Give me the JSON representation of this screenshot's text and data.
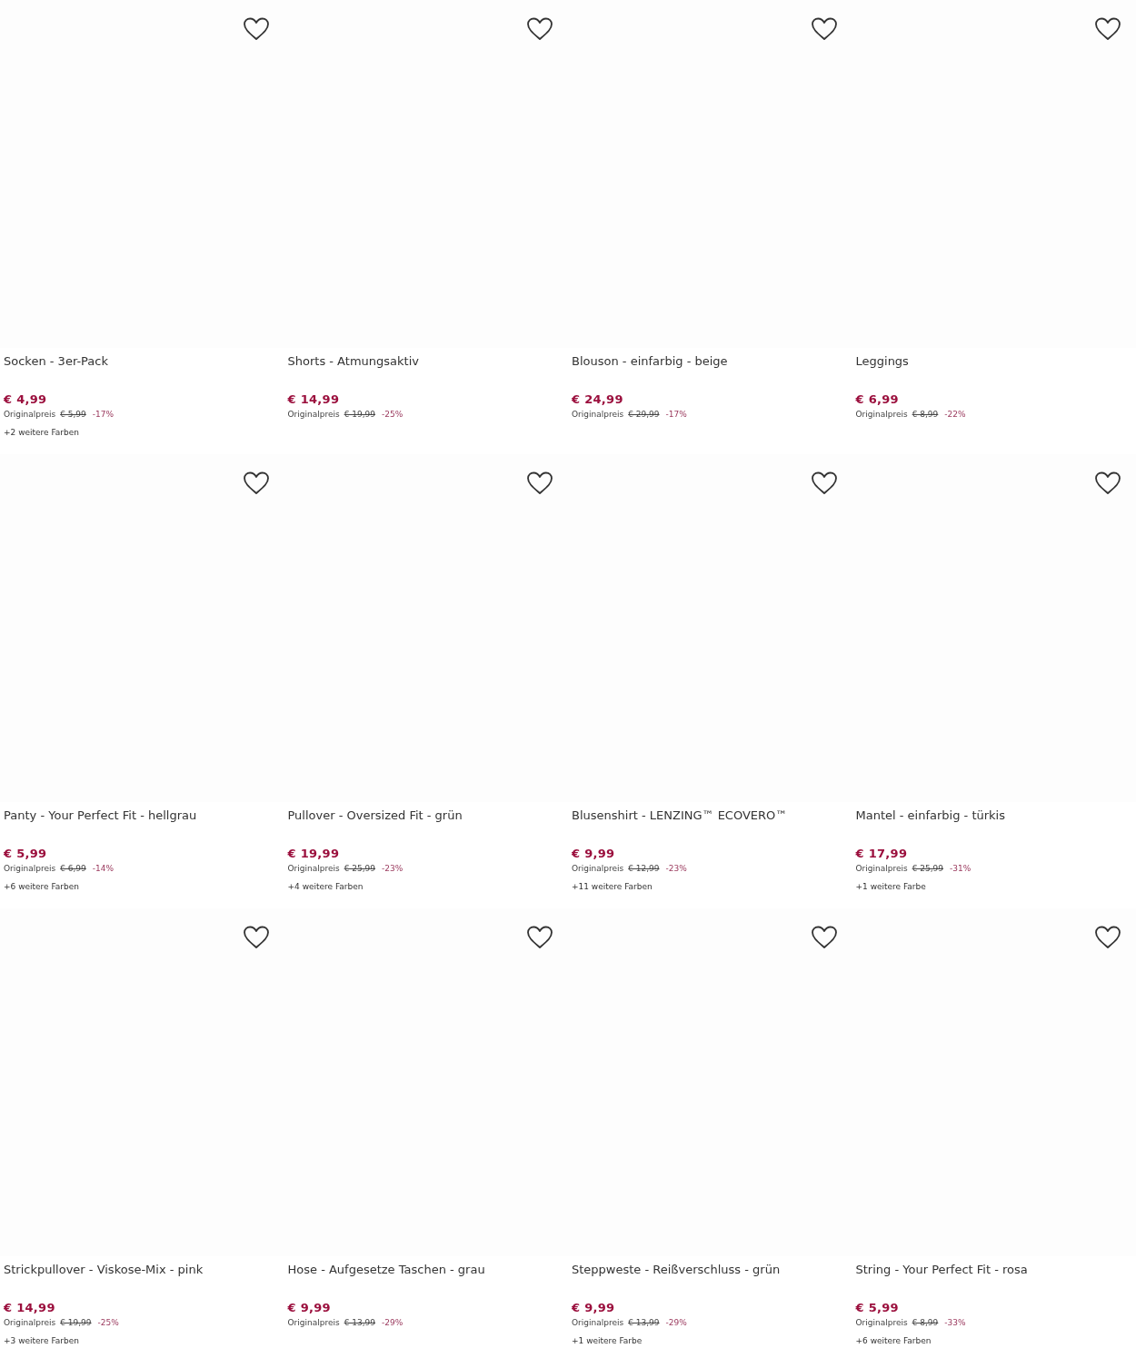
{
  "products": [
    {
      "name": "Socken - 3er-Pack",
      "price": "€ 4,99",
      "original_label": "Originalpreis",
      "original_price": "€ 5,99",
      "discount": "-17%",
      "colors": "+2 weitere Farben"
    },
    {
      "name": "Shorts - Atmungsaktiv",
      "price": "€ 14,99",
      "original_label": "Originalpreis",
      "original_price": "€ 19,99",
      "discount": "-25%"
    },
    {
      "name": "Blouson - einfarbig - beige",
      "price": "€ 24,99",
      "original_label": "Originalpreis",
      "original_price": "€ 29,99",
      "discount": "-17%"
    },
    {
      "name": "Leggings",
      "price": "€ 6,99",
      "original_label": "Originalpreis",
      "original_price": "€ 8,99",
      "discount": "-22%"
    },
    {
      "name": "Panty - Your Perfect Fit - hellgrau",
      "price": "€ 5,99",
      "original_label": "Originalpreis",
      "original_price": "€ 6,99",
      "discount": "-14%",
      "colors": "+6 weitere Farben"
    },
    {
      "name": "Pullover - Oversized Fit - grün",
      "price": "€ 19,99",
      "original_label": "Originalpreis",
      "original_price": "€ 25,99",
      "discount": "-23%",
      "colors": "+4 weitere Farben"
    },
    {
      "name": "Blusenshirt - LENZING™ ECOVERO™",
      "price": "€ 9,99",
      "original_label": "Originalpreis",
      "original_price": "€ 12,99",
      "discount": "-23%",
      "colors": "+11 weitere Farben"
    },
    {
      "name": "Mantel - einfarbig - türkis",
      "price": "€ 17,99",
      "original_label": "Originalpreis",
      "original_price": "€ 25,99",
      "discount": "-31%",
      "colors": "+1 weitere Farbe"
    },
    {
      "name": "Strickpullover - Viskose-Mix - pink",
      "price": "€ 14,99",
      "original_label": "Originalpreis",
      "original_price": "€ 19,99",
      "discount": "-25%",
      "colors": "+3 weitere Farben"
    },
    {
      "name": "Hose - Aufgesetze Taschen - grau",
      "price": "€ 9,99",
      "original_label": "Originalpreis",
      "original_price": "€ 13,99",
      "discount": "-29%"
    },
    {
      "name": "Steppweste - Reißverschluss - grün",
      "price": "€ 9,99",
      "original_label": "Originalpreis",
      "original_price": "€ 13,99",
      "discount": "-29%",
      "colors": "+1 weitere Farbe"
    },
    {
      "name": "String - Your Perfect Fit - rosa",
      "price": "€ 5,99",
      "original_label": "Originalpreis",
      "original_price": "€ 8,99",
      "discount": "-33%",
      "colors": "+6 weitere Farben"
    }
  ]
}
